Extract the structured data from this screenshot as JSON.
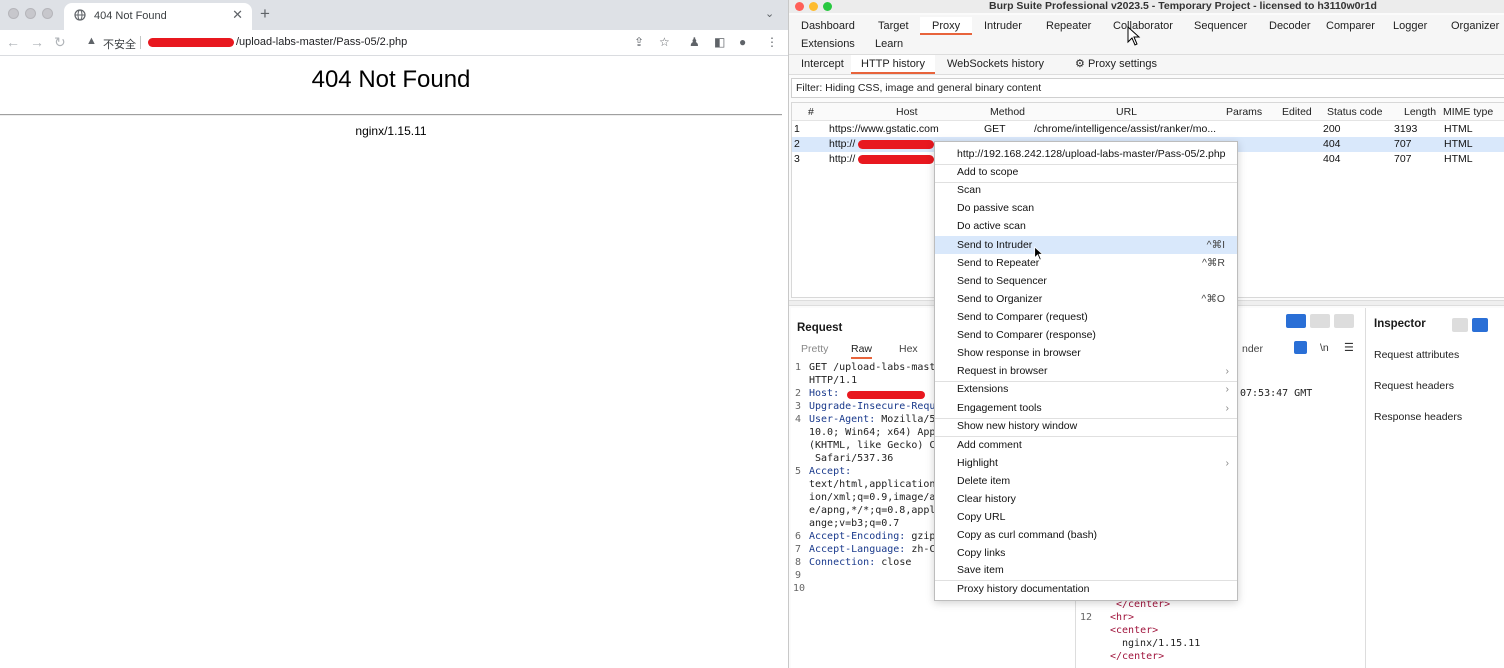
{
  "browser": {
    "tab_title": "404 Not Found",
    "insecure_label": "不安全",
    "url_suffix": "/upload-labs-master/Pass-05/2.php",
    "page_heading": "404 Not Found",
    "page_server": "nginx/1.15.11"
  },
  "burp": {
    "window_title": "Burp Suite Professional v2023.5 - Temporary Project - licensed to h3110w0r1d",
    "main_tabs": [
      "Dashboard",
      "Target",
      "Proxy",
      "Intruder",
      "Repeater",
      "Collaborator",
      "Sequencer",
      "Decoder",
      "Comparer",
      "Logger",
      "Organizer",
      "Extensions",
      "Learn"
    ],
    "sub_tabs": [
      "Intercept",
      "HTTP history",
      "WebSockets history",
      "Proxy settings"
    ],
    "filter": "Filter: Hiding CSS, image and general binary content",
    "columns": [
      "#",
      "Host",
      "Method",
      "URL",
      "Params",
      "Edited",
      "Status code",
      "Length",
      "MIME type"
    ],
    "rows": [
      {
        "num": "1",
        "host": "https://www.gstatic.com",
        "method": "GET",
        "url": "/chrome/intelligence/assist/ranker/mo...",
        "status": "200",
        "length": "3193",
        "mime": "HTML"
      },
      {
        "num": "2",
        "host": "http://",
        "method": "",
        "url": "",
        "status": "404",
        "length": "707",
        "mime": "HTML"
      },
      {
        "num": "3",
        "host": "http://",
        "method": "",
        "url": "",
        "status": "404",
        "length": "707",
        "mime": "HTML"
      }
    ],
    "request": {
      "title": "Request",
      "tabs": [
        "Pretty",
        "Raw",
        "Hex"
      ],
      "lines": [
        {
          "n": "1",
          "key": "",
          "text": "GET /upload-labs-mast"
        },
        {
          "n": "",
          "key": "",
          "text": "HTTP/1.1"
        },
        {
          "n": "2",
          "key": "Host:",
          "text": ""
        },
        {
          "n": "3",
          "key": "Upgrade-Insecure-Requ",
          "text": ""
        },
        {
          "n": "4",
          "key": "User-Agent:",
          "text": " Mozilla/5"
        },
        {
          "n": "",
          "key": "",
          "text": "10.0; Win64; x64) App"
        },
        {
          "n": "",
          "key": "",
          "text": "(KHTML, like Gecko) C"
        },
        {
          "n": "",
          "key": "",
          "text": " Safari/537.36"
        },
        {
          "n": "5",
          "key": "Accept:",
          "text": ""
        },
        {
          "n": "",
          "key": "",
          "text": "text/html,application"
        },
        {
          "n": "",
          "key": "",
          "text": "ion/xml;q=0.9,image/a"
        },
        {
          "n": "",
          "key": "",
          "text": "e/apng,*/*;q=0.8,appl"
        },
        {
          "n": "",
          "key": "",
          "text": "ange;v=b3;q=0.7"
        },
        {
          "n": "6",
          "key": "Accept-Encoding:",
          "text": " gzip"
        },
        {
          "n": "7",
          "key": "Accept-Language:",
          "text": " zh-C"
        },
        {
          "n": "8",
          "key": "Connection:",
          "text": " close"
        },
        {
          "n": "9",
          "key": "",
          "text": ""
        },
        {
          "n": "10",
          "key": "",
          "text": ""
        }
      ]
    },
    "response": {
      "render_label": "nder",
      "date_fragment": "07:53:47 GMT",
      "line_12": "12",
      "code": [
        "</center>",
        "<hr>",
        "<center>",
        "nginx/1.15.11",
        "</center>"
      ]
    },
    "inspector": {
      "title": "Inspector",
      "sections": [
        "Request attributes",
        "Request headers",
        "Response headers"
      ]
    },
    "context_menu": {
      "items": [
        {
          "label": "http://192.168.242.128/upload-labs-master/Pass-05/2.php",
          "shortcut": "",
          "sub": false
        },
        {
          "label": "Add to scope",
          "shortcut": "",
          "sub": false
        },
        {
          "label": "Scan",
          "shortcut": "",
          "sub": false
        },
        {
          "label": "Do passive scan",
          "shortcut": "",
          "sub": false
        },
        {
          "label": "Do active scan",
          "shortcut": "",
          "sub": false
        },
        {
          "label": "Send to Intruder",
          "shortcut": "^⌘I",
          "sub": false
        },
        {
          "label": "Send to Repeater",
          "shortcut": "^⌘R",
          "sub": false
        },
        {
          "label": "Send to Sequencer",
          "shortcut": "",
          "sub": false
        },
        {
          "label": "Send to Organizer",
          "shortcut": "^⌘O",
          "sub": false
        },
        {
          "label": "Send to Comparer (request)",
          "shortcut": "",
          "sub": false
        },
        {
          "label": "Send to Comparer (response)",
          "shortcut": "",
          "sub": false
        },
        {
          "label": "Show response in browser",
          "shortcut": "",
          "sub": false
        },
        {
          "label": "Request in browser",
          "shortcut": "",
          "sub": true
        },
        {
          "label": "Extensions",
          "shortcut": "",
          "sub": true
        },
        {
          "label": "Engagement tools",
          "shortcut": "",
          "sub": true
        },
        {
          "label": "Show new history window",
          "shortcut": "",
          "sub": false
        },
        {
          "label": "Add comment",
          "shortcut": "",
          "sub": false
        },
        {
          "label": "Highlight",
          "shortcut": "",
          "sub": true
        },
        {
          "label": "Delete item",
          "shortcut": "",
          "sub": false
        },
        {
          "label": "Clear history",
          "shortcut": "",
          "sub": false
        },
        {
          "label": "Copy URL",
          "shortcut": "",
          "sub": false
        },
        {
          "label": "Copy as curl command (bash)",
          "shortcut": "",
          "sub": false
        },
        {
          "label": "Copy links",
          "shortcut": "",
          "sub": false
        },
        {
          "label": "Save item",
          "shortcut": "",
          "sub": false
        },
        {
          "label": "Proxy history documentation",
          "shortcut": "",
          "sub": false
        }
      ],
      "highlighted": "Send to Intruder"
    },
    "colors": {
      "accent": "#e8643c",
      "selection": "#d9e8fb",
      "redaction": "#e8181f"
    }
  }
}
